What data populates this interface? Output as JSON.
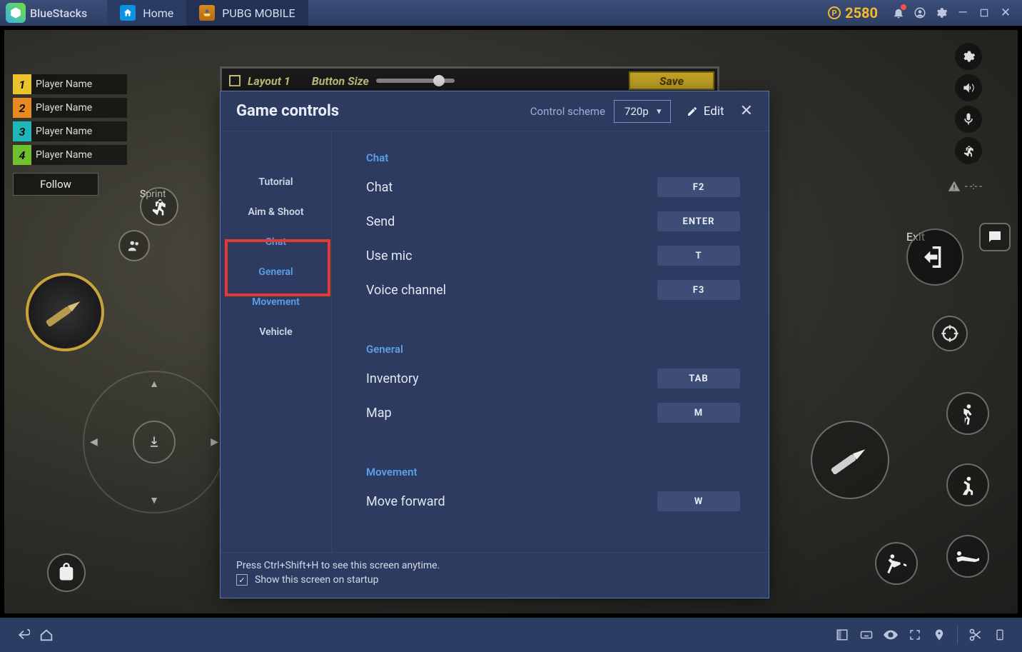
{
  "app": {
    "brand": "BlueStacks"
  },
  "tabs": {
    "home": "Home",
    "game": "PUBG MOBILE"
  },
  "coins": "2580",
  "players": [
    {
      "num": "1",
      "name": "Player Name",
      "color": "#e9c22c"
    },
    {
      "num": "2",
      "name": "Player Name",
      "color": "#e88a1f"
    },
    {
      "num": "3",
      "name": "Player Name",
      "color": "#1fb6ba"
    },
    {
      "num": "4",
      "name": "Player Name",
      "color": "#6fbf2f"
    }
  ],
  "hud": {
    "follow": "Follow",
    "sprint": "Sprint",
    "exit": "Exit",
    "distance": "- -:- -"
  },
  "behind_bar": {
    "layout_label": "Layout 1",
    "button_size_label": "Button Size",
    "save": "Save"
  },
  "modal": {
    "title": "Game controls",
    "control_scheme_label": "Control scheme",
    "scheme_value": "720p",
    "edit_label": "Edit",
    "sidebar": {
      "tutorial": "Tutorial",
      "aim_shoot": "Aim & Shoot",
      "chat": "Chat",
      "general": "General",
      "movement": "Movement",
      "vehicle": "Vehicle"
    },
    "sections": {
      "chat": {
        "title": "Chat",
        "rows": [
          {
            "label": "Chat",
            "key": "F2"
          },
          {
            "label": "Send",
            "key": "ENTER"
          },
          {
            "label": "Use mic",
            "key": "T"
          },
          {
            "label": "Voice channel",
            "key": "F3"
          }
        ]
      },
      "general": {
        "title": "General",
        "rows": [
          {
            "label": "Inventory",
            "key": "TAB"
          },
          {
            "label": "Map",
            "key": "M"
          }
        ]
      },
      "movement": {
        "title": "Movement",
        "rows": [
          {
            "label": "Move forward",
            "key": "W"
          }
        ]
      }
    },
    "footer": {
      "tip": "Press Ctrl+Shift+H to see this screen anytime.",
      "checkbox": "Show this screen on startup",
      "checked": true
    }
  }
}
